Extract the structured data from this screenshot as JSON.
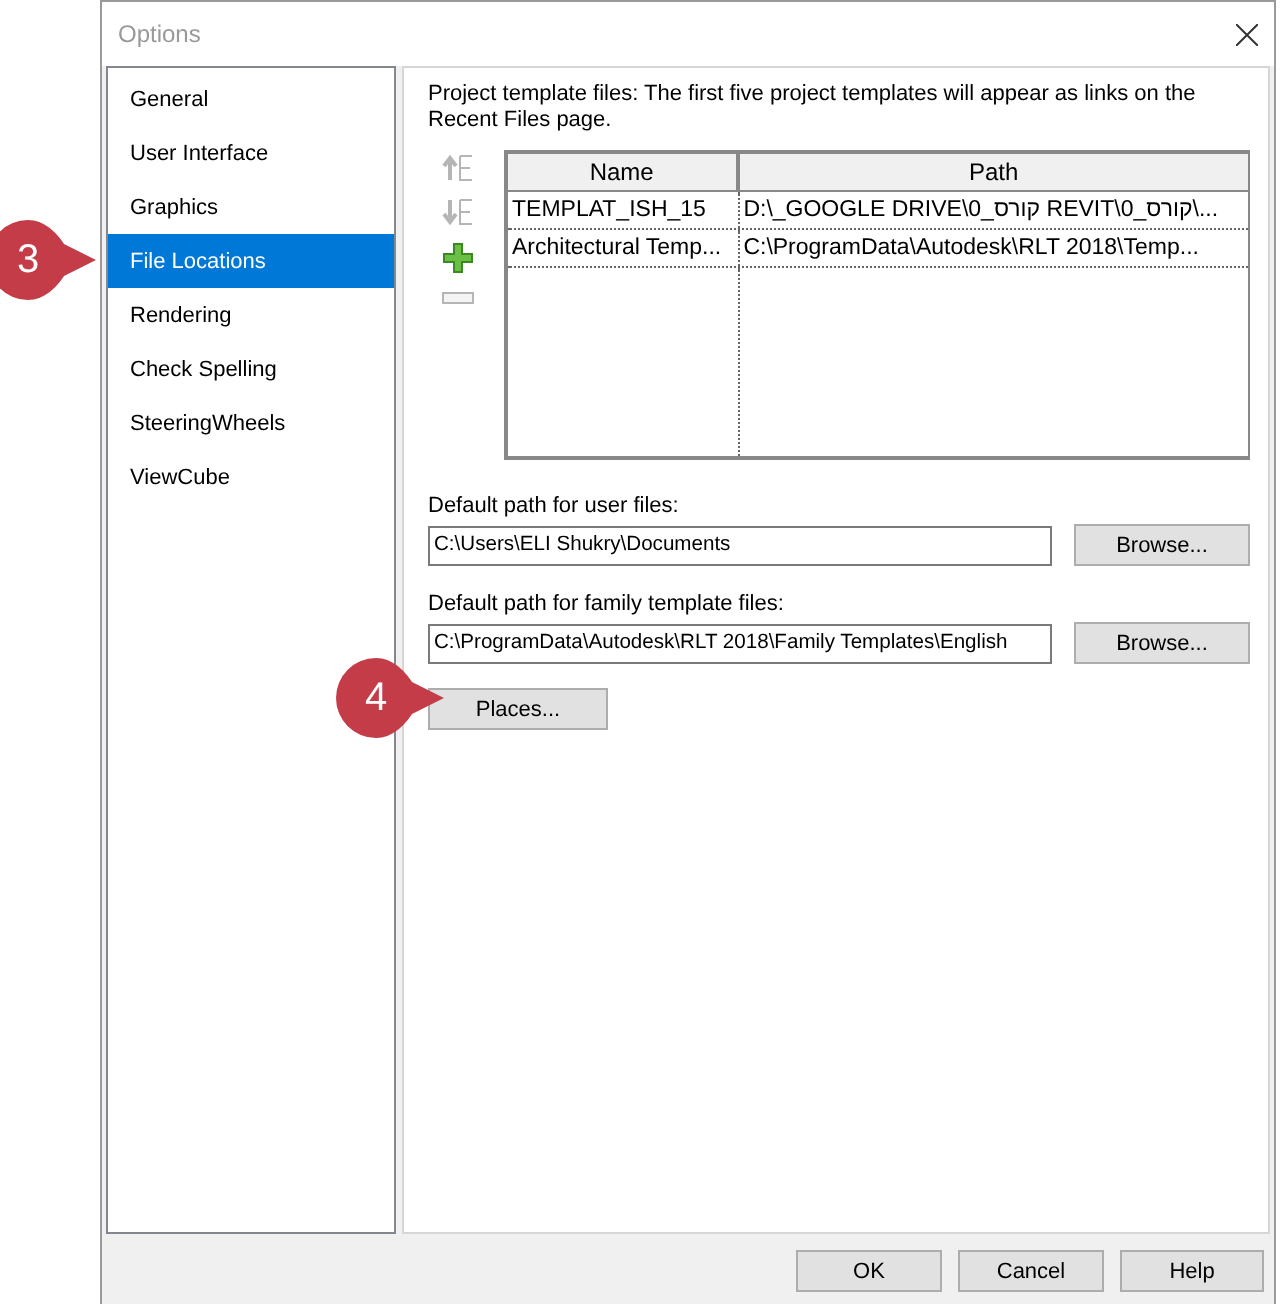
{
  "window": {
    "title": "Options"
  },
  "sidebar": {
    "items": [
      {
        "label": "General",
        "selected": false
      },
      {
        "label": "User Interface",
        "selected": false
      },
      {
        "label": "Graphics",
        "selected": false
      },
      {
        "label": "File Locations",
        "selected": true
      },
      {
        "label": "Rendering",
        "selected": false
      },
      {
        "label": "Check Spelling",
        "selected": false
      },
      {
        "label": "SteeringWheels",
        "selected": false
      },
      {
        "label": "ViewCube",
        "selected": false
      }
    ]
  },
  "templates": {
    "description": "Project template files:  The first five project templates will appear as links on the Recent Files page.",
    "tools": [
      {
        "kind": "move-up",
        "disabled": true
      },
      {
        "kind": "move-down",
        "disabled": true
      },
      {
        "kind": "add",
        "disabled": false
      },
      {
        "kind": "remove",
        "disabled": true
      }
    ],
    "columns": [
      "Name",
      "Path"
    ],
    "rows": [
      [
        "TEMPLAT_ISH_15",
        "D:\\_GOOGLE DRIVE\\0_קורס REVIT\\0_קורס\\..."
      ],
      [
        "Architectural Temp...",
        "C:\\ProgramData\\Autodesk\\RLT 2018\\Temp..."
      ]
    ]
  },
  "fields": [
    {
      "label": "Default path for user files:",
      "value": "C:\\Users\\ELI Shukry\\Documents",
      "button": "Browse..."
    },
    {
      "label": "Default path for family template files:",
      "value": "C:\\ProgramData\\Autodesk\\RLT 2018\\Family Templates\\English",
      "button": "Browse..."
    }
  ],
  "places_button": "Places...",
  "buttons": [
    "OK",
    "Cancel",
    "Help"
  ],
  "callouts": [
    {
      "number": "3"
    },
    {
      "number": "4"
    }
  ]
}
